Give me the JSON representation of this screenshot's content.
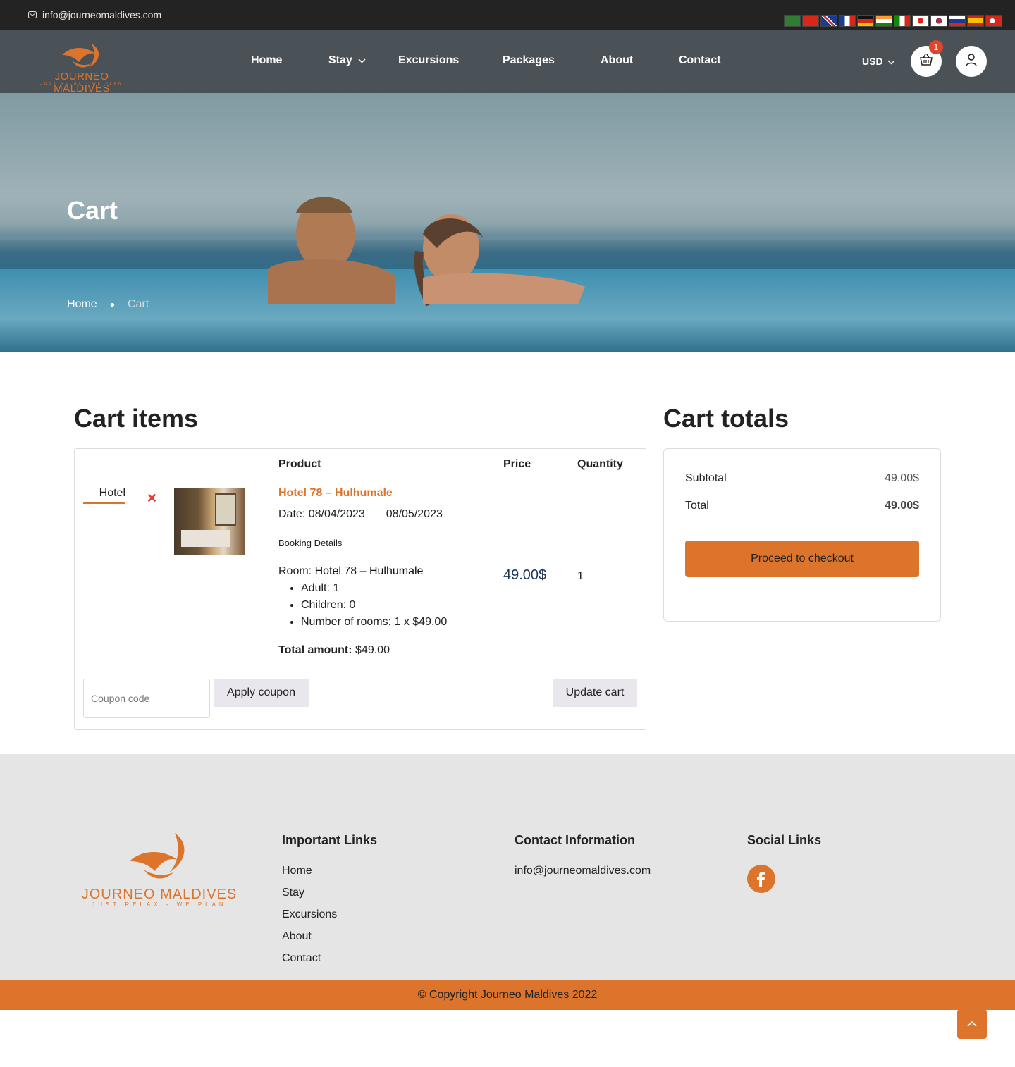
{
  "topbar": {
    "email": "info@journeomaldives.com",
    "flags": [
      "ar",
      "zh",
      "en",
      "fr",
      "de",
      "hi",
      "it",
      "ja",
      "ko",
      "ru",
      "es",
      "tr"
    ]
  },
  "header": {
    "logo_text": "JOURNEO MALDIVES",
    "logo_tagline": "JUST RELAX - WE PLAN",
    "nav": [
      {
        "label": "Home"
      },
      {
        "label": "Stay"
      },
      {
        "label": "Excursions"
      },
      {
        "label": "Packages"
      },
      {
        "label": "About"
      },
      {
        "label": "Contact"
      }
    ],
    "currency": "USD",
    "cart_count": "1"
  },
  "hero": {
    "title": "Cart",
    "breadcrumb_home": "Home",
    "breadcrumb_current": "Cart"
  },
  "cart": {
    "heading": "Cart items",
    "columns": {
      "product": "Product",
      "price": "Price",
      "quantity": "Quantity"
    },
    "item": {
      "type_label": "Hotel",
      "name": "Hotel 78 – Hulhumale",
      "date_label": "Date:",
      "date_from": "08/04/2023",
      "date_to": "08/05/2023",
      "booking_details": "Booking Details",
      "room_label": "Room:",
      "room_name": "Hotel 78 – Hulhumale",
      "details": [
        "Adult: 1",
        "Children: 0",
        "Number of rooms: 1 x $49.00"
      ],
      "total_label": "Total amount:",
      "total_value": "$49.00",
      "price": "49.00$",
      "quantity": "1"
    },
    "coupon_placeholder": "Coupon code",
    "apply_coupon": "Apply coupon",
    "update_cart": "Update cart"
  },
  "totals": {
    "heading": "Cart totals",
    "subtotal_label": "Subtotal",
    "subtotal_value": "49.00$",
    "total_label": "Total",
    "total_value": "49.00$",
    "checkout": "Proceed to checkout"
  },
  "footer": {
    "important_links_title": "Important Links",
    "links": [
      "Home",
      "Stay",
      "Excursions",
      "About",
      "Contact"
    ],
    "contact_title": "Contact Information",
    "contact_email": "info@journeomaldives.com",
    "social_title": "Social Links",
    "copyright": "© Copyright Journeo Maldives 2022"
  },
  "colors": {
    "accent": "#dd742c",
    "header": "#4a5257",
    "topbar": "#232323"
  }
}
